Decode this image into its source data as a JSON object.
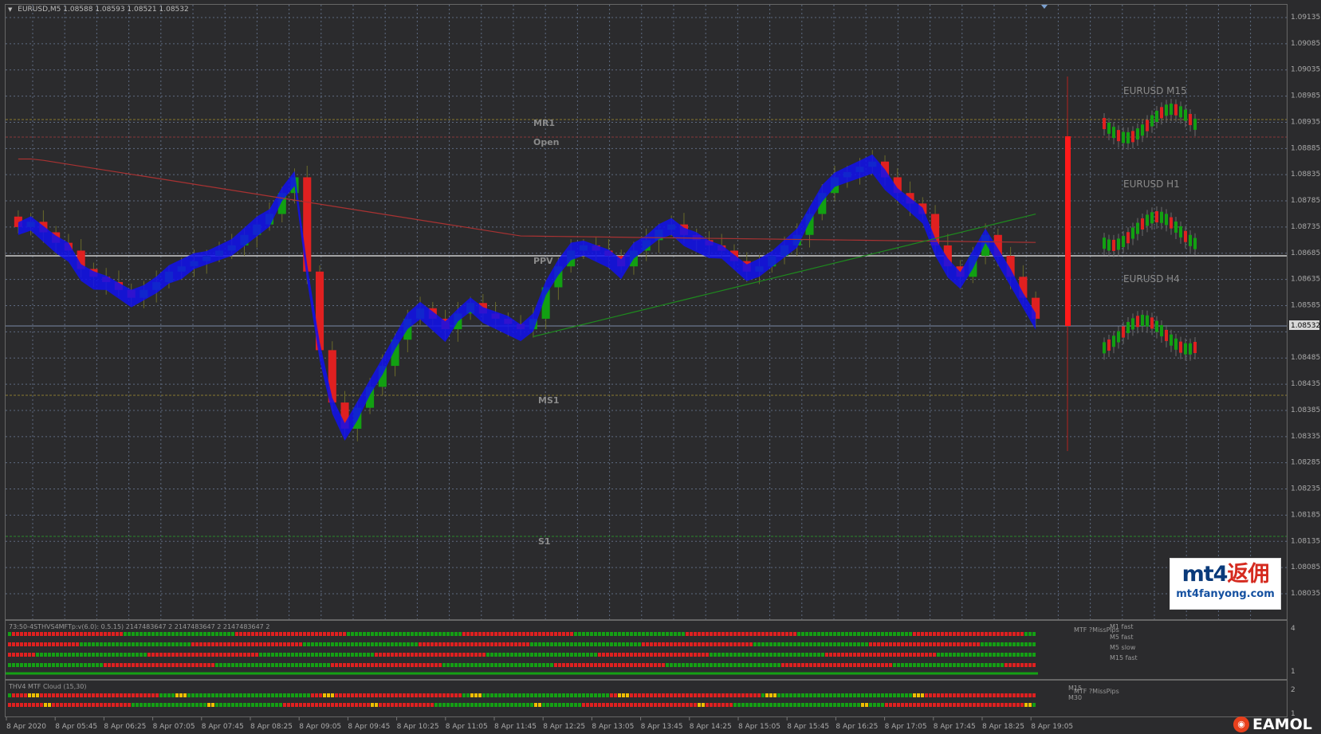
{
  "window": {
    "title": "EURUSD,M5",
    "ohlc": "1.08588 1.08593 1.08521 1.08532"
  },
  "price_axis": {
    "labels": [
      "1.09135",
      "1.09085",
      "1.09035",
      "1.08985",
      "1.08935",
      "1.08885",
      "1.08835",
      "1.08785",
      "1.08735",
      "1.08685",
      "1.08635",
      "1.08585",
      "1.08532",
      "1.08485",
      "1.08435",
      "1.08385",
      "1.08335",
      "1.08285",
      "1.08235",
      "1.08185",
      "1.08135",
      "1.08085",
      "1.08035"
    ],
    "current": "1.08532"
  },
  "time_axis": {
    "labels": [
      "8 Apr 2020",
      "8 Apr 05:45",
      "8 Apr 06:25",
      "8 Apr 07:05",
      "8 Apr 07:45",
      "8 Apr 08:25",
      "8 Apr 09:05",
      "8 Apr 09:45",
      "8 Apr 10:25",
      "8 Apr 11:05",
      "8 Apr 11:45",
      "8 Apr 12:25",
      "8 Apr 13:05",
      "8 Apr 13:45",
      "8 Apr 14:25",
      "8 Apr 15:05",
      "8 Apr 15:45",
      "8 Apr 16:25",
      "8 Apr 17:05",
      "8 Apr 17:45",
      "8 Apr 18:25",
      "8 Apr 19:05"
    ]
  },
  "levels": {
    "mr1": "MR1",
    "open": "Open",
    "ppv": "PPV",
    "ms1": "MS1",
    "s1": "S1"
  },
  "mtf_titles": {
    "m15": "EURUSD M15",
    "h1": "EURUSD H1",
    "h4": "EURUSD H4"
  },
  "indicator1": {
    "header": "73:50-4STHVS4MFTp:v(6.0): 0.5.15) 2147483647 2 2147483647 2 2147483647 2",
    "title": "MTF ?MissPips",
    "rows": [
      "M1 fast",
      "M5 fast",
      "M5 slow",
      "M15 fast"
    ],
    "scale_top": "4",
    "scale_bottom": "1"
  },
  "indicator2": {
    "header": "THV4 MTF Cloud (15,30)",
    "title": "MTF ?MissPips",
    "rows": [
      "M15",
      "M30"
    ],
    "scale_top": "2",
    "scale_bottom": "1"
  },
  "logo": {
    "main_a": "mt4",
    "main_b": "返佣",
    "sub": "mt4fanyong.com"
  },
  "watermark": {
    "text": "EAMOL"
  },
  "colors": {
    "bull": "#12a012",
    "bear": "#e02020",
    "cloud": "#1010ee",
    "grid": "#5e6a80",
    "ma_red": "#a83232",
    "ma_green": "#1e8a1e",
    "dot_yellow": "#f0c000"
  },
  "chart_data": {
    "type": "candlestick",
    "symbol": "EURUSD",
    "timeframe": "M5",
    "ylim": [
      1.08035,
      1.09135
    ],
    "close_series": [
      1.08735,
      1.08745,
      1.08725,
      1.08705,
      1.0869,
      1.08655,
      1.0864,
      1.0863,
      1.08615,
      1.086,
      1.08615,
      1.0863,
      1.0865,
      1.0866,
      1.0867,
      1.0868,
      1.0869,
      1.087,
      1.0872,
      1.0874,
      1.0876,
      1.088,
      1.0883,
      1.0865,
      1.085,
      1.084,
      1.0835,
      1.0839,
      1.0843,
      1.0847,
      1.0852,
      1.0856,
      1.0858,
      1.0856,
      1.0854,
      1.0857,
      1.0859,
      1.0857,
      1.0856,
      1.0855,
      1.0854,
      1.0856,
      1.0862,
      1.0866,
      1.0869,
      1.087,
      1.0869,
      1.0868,
      1.0866,
      1.0869,
      1.0871,
      1.0873,
      1.0874,
      1.0872,
      1.0871,
      1.087,
      1.0869,
      1.0867,
      1.0865,
      1.0866,
      1.0868,
      1.087,
      1.0872,
      1.0876,
      1.088,
      1.0883,
      1.0884,
      1.0885,
      1.0886,
      1.0883,
      1.088,
      1.0878,
      1.0876,
      1.087,
      1.0866,
      1.0864,
      1.0868,
      1.0872,
      1.0868,
      1.0864,
      1.086,
      1.0856
    ],
    "last_price": 1.08532
  }
}
